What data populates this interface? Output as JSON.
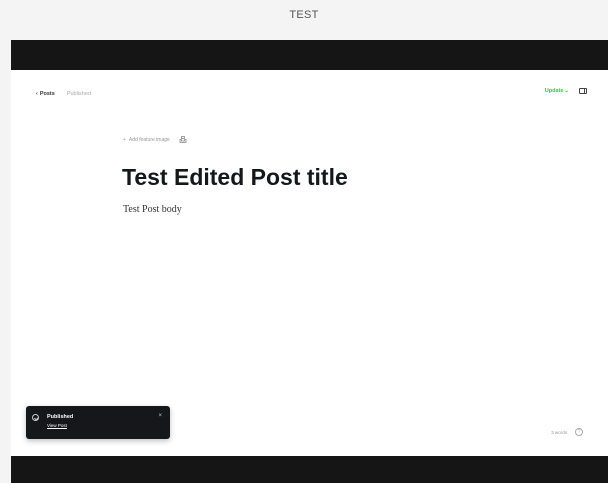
{
  "caption": "TEST",
  "header": {
    "back_arrow": "‹",
    "back_label": "Posts",
    "status": "Published",
    "update_label": "Update",
    "update_chevron": "⌄"
  },
  "editor": {
    "feature_plus": "+",
    "add_feature_image": "Add feature image",
    "title": "Test Edited Post title",
    "body": "Test Post body"
  },
  "toast": {
    "title": "Published",
    "link": "View Post",
    "close": "×"
  },
  "footer": {
    "word_count": "3 words",
    "help": "?"
  },
  "colors": {
    "accent": "#30cf43",
    "bar": "#151515",
    "toast_bg": "#15171a"
  },
  "icons": {
    "settings_icon": "sidebar-toggle-icon",
    "image_icon": "unsplash-icon",
    "toast_icon": "check-circle-icon"
  }
}
